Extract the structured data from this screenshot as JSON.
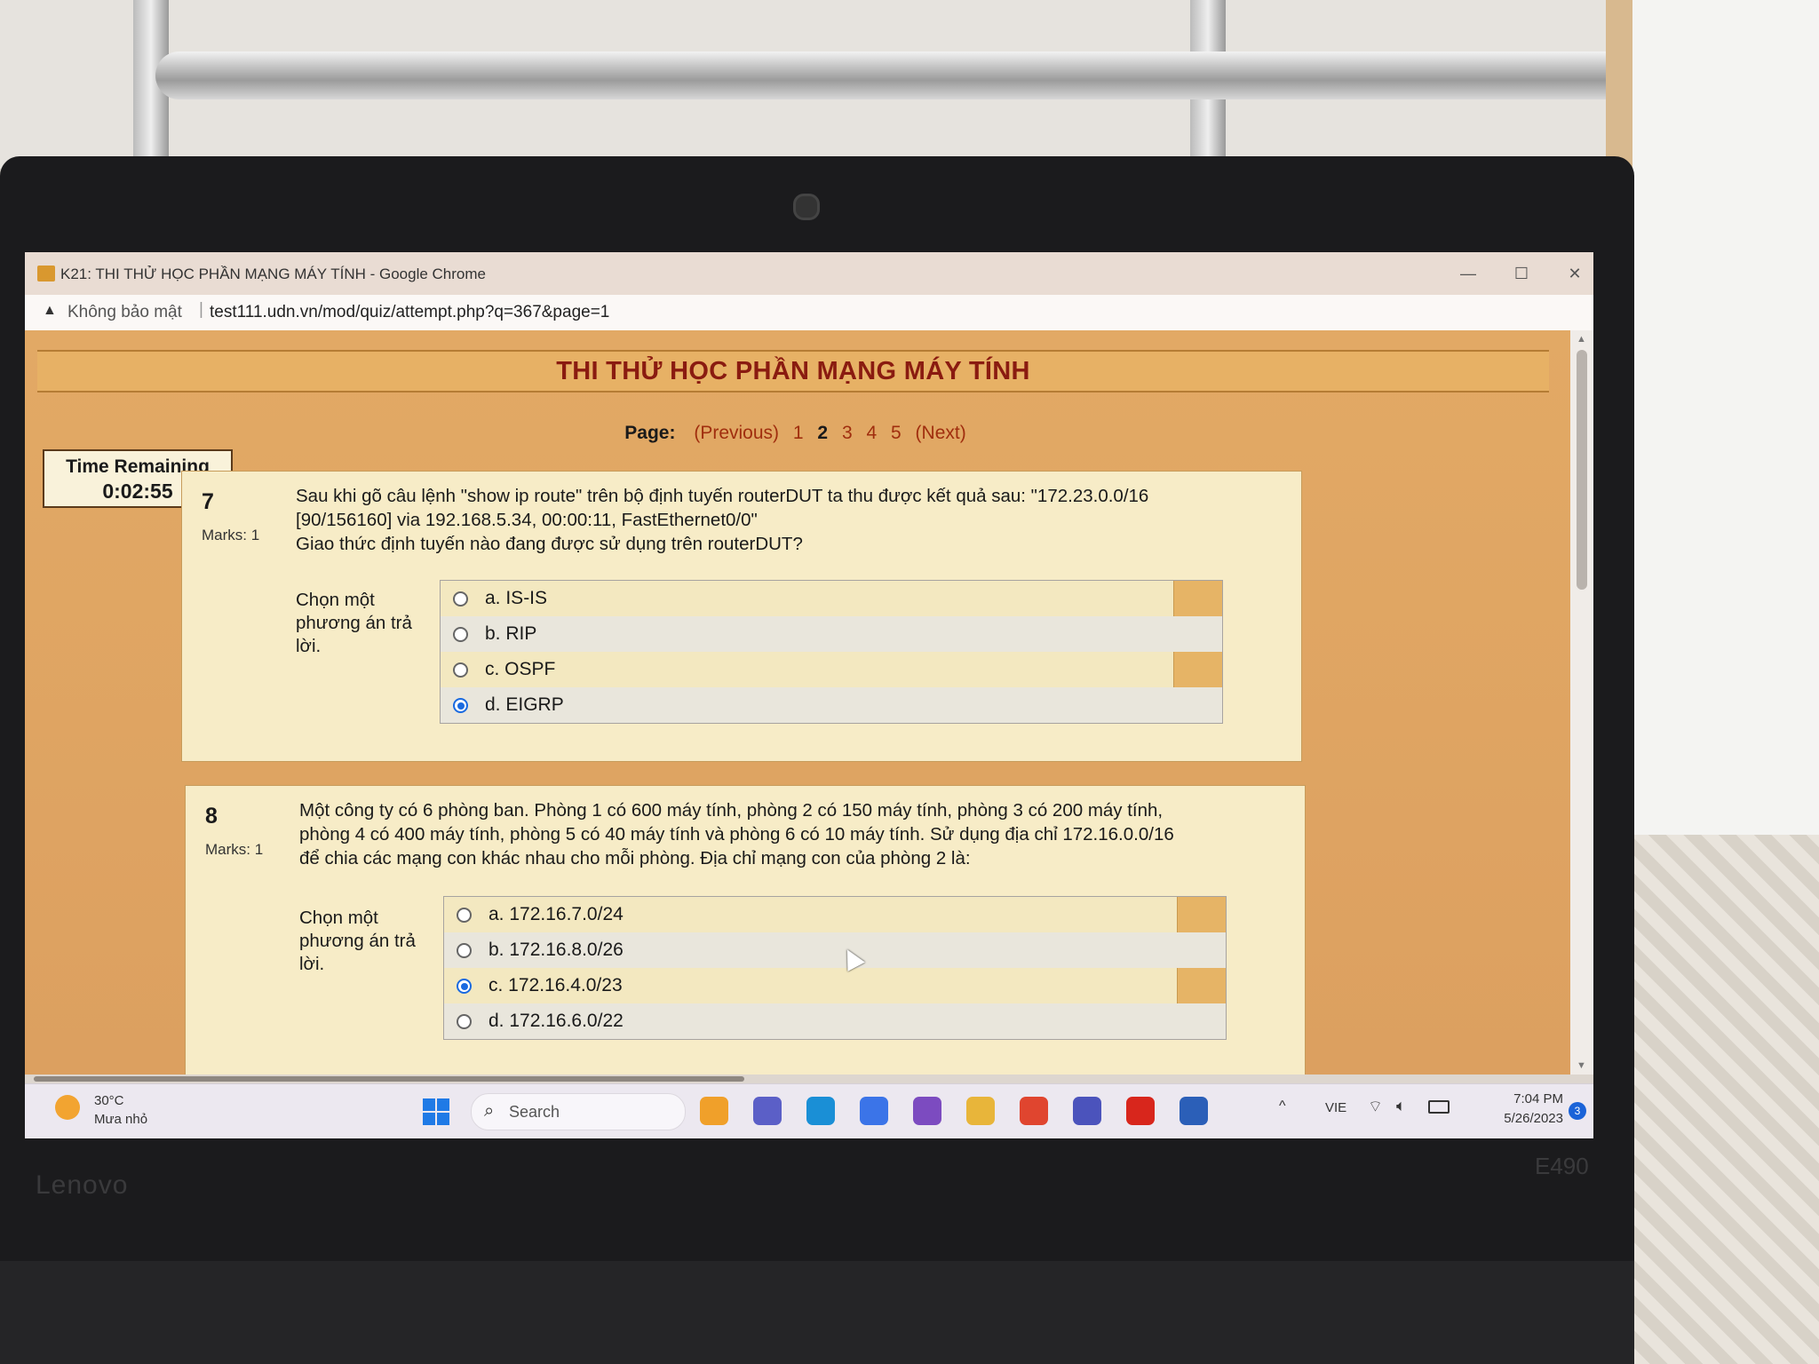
{
  "window": {
    "title": "K21: THI THỬ HỌC PHẦN MẠNG MÁY TÍNH - Google Chrome",
    "minimize": "—",
    "maximize": "☐",
    "close": "✕"
  },
  "address_bar": {
    "security": "Không bảo mật",
    "separator": "|",
    "url": "test111.udn.vn/mod/quiz/attempt.php?q=367&page=1"
  },
  "page": {
    "heading": "THI THỬ HỌC PHẦN MẠNG MÁY TÍNH",
    "pager": {
      "label": "Page:",
      "previous": "(Previous)",
      "pages": [
        "1",
        "2",
        "3",
        "4",
        "5"
      ],
      "current_page": "2",
      "next": "(Next)"
    },
    "timer": {
      "label": "Time Remaining",
      "value": "0:02:55"
    },
    "questions": [
      {
        "number": "7",
        "marks": "Marks: 1",
        "text_lines": [
          "Sau khi gõ câu lệnh \"show ip route\" trên bộ định tuyến routerDUT ta thu được kết quả sau: \"172.23.0.0/16",
          "[90/156160] via 192.168.5.34, 00:00:11, FastEthernet0/0\"",
          "Giao thức định tuyến nào đang được sử dụng trên routerDUT?"
        ],
        "prompt": "Chọn một phương án trả lời.",
        "options": [
          {
            "label": "a. IS-IS",
            "selected": false
          },
          {
            "label": "b. RIP",
            "selected": false
          },
          {
            "label": "c. OSPF",
            "selected": false
          },
          {
            "label": "d. EIGRP",
            "selected": true
          }
        ]
      },
      {
        "number": "8",
        "marks": "Marks: 1",
        "text_lines": [
          "Một công ty có 6 phòng ban. Phòng 1 có 600 máy tính, phòng 2 có 150 máy tính, phòng 3 có 200 máy tính,",
          "phòng 4 có 400 máy tính, phòng 5 có 40 máy tính và phòng 6 có 10 máy tính. Sử dụng địa chỉ 172.16.0.0/16",
          "để chia các mạng con khác nhau cho mỗi phòng. Địa chỉ mạng con của phòng 2 là:"
        ],
        "prompt": "Chọn một phương án trả lời.",
        "options": [
          {
            "label": "a. 172.16.7.0/24",
            "selected": false
          },
          {
            "label": "b. 172.16.8.0/26",
            "selected": false
          },
          {
            "label": "c. 172.16.4.0/23",
            "selected": true
          },
          {
            "label": "d. 172.16.6.0/22",
            "selected": false
          }
        ]
      }
    ]
  },
  "taskbar": {
    "weather_temp": "30°C",
    "weather_desc": "Mưa nhỏ",
    "search_placeholder": "Search",
    "language": "VIE",
    "time": "7:04 PM",
    "date": "5/26/2023",
    "notification_count": "3",
    "apps": [
      "widgets-icon",
      "chat-icon",
      "edge-icon",
      "copilot-icon",
      "visual-studio-icon",
      "file-explorer-icon",
      "chrome-icon",
      "teams-icon",
      "acrobat-icon",
      "word-icon"
    ],
    "app_colors": [
      "#f0a02a",
      "#5b5fc7",
      "#1a8fd6",
      "#3b74e8",
      "#7c4bc0",
      "#e8b53a",
      "#e0452f",
      "#4b53bc",
      "#d8261c",
      "#2b5fb8"
    ]
  },
  "device": {
    "brand": "Lenovo",
    "model": "E490"
  },
  "colors": {
    "page_bg": "#dca060",
    "heading": "#8a1b10",
    "link": "#a02e0e",
    "radio_selected": "#1a6ae0"
  }
}
